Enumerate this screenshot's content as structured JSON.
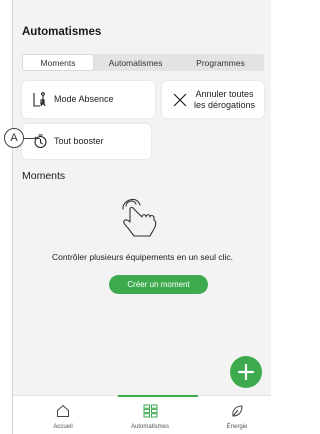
{
  "header": {
    "title": "Automatismes"
  },
  "tabs": [
    {
      "label": "Moments",
      "active": true
    },
    {
      "label": "Automatismes",
      "active": false
    },
    {
      "label": "Programmes",
      "active": false
    }
  ],
  "cards": {
    "mode_absence": {
      "label": "Mode Absence",
      "icon": "person-luggage-icon"
    },
    "cancel_overrides": {
      "line1": "Annuler toutes",
      "line2": "les dérogations",
      "icon": "close-icon"
    },
    "boost_all": {
      "label": "Tout booster",
      "icon": "timer-boost-icon"
    }
  },
  "callout": {
    "label": "A"
  },
  "moments": {
    "section_title": "Moments",
    "info_text": "Contrôler plusieurs équipements en un seul clic.",
    "create_button": "Créer un moment"
  },
  "bottom_nav": [
    {
      "label": "Accueil",
      "icon": "home-icon"
    },
    {
      "label": "Automatismes",
      "icon": "grid-icon",
      "active": true
    },
    {
      "label": "Énergie",
      "icon": "leaf-icon"
    }
  ],
  "colors": {
    "accent": "#3daa4d",
    "background": "#f3f3f3",
    "card": "#ffffff"
  }
}
